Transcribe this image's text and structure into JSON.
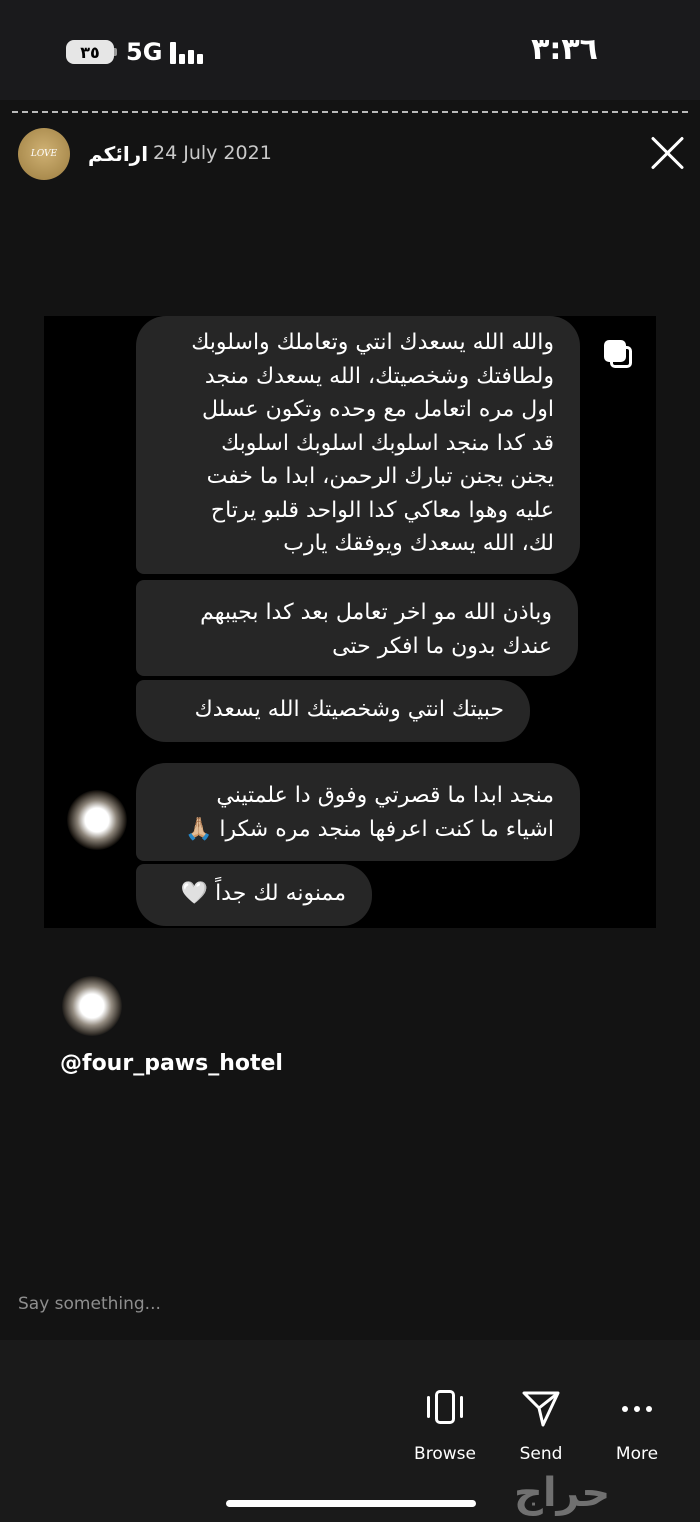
{
  "status_bar": {
    "battery": "٣٥",
    "network": "5G",
    "time": "٣:٣٦"
  },
  "story": {
    "username": "ارائكم",
    "date": "24 July 2021",
    "avatar_text": "LOVE",
    "mention": "@four_paws_hotel",
    "reply_placeholder": "Say something..."
  },
  "screenshot": {
    "messages": [
      "والله الله يسعدك انتي وتعاملك واسلوبك\nولطافتك وشخصيتك، الله يسعدك منجد\nاول مره اتعامل مع وحده وتكون عسلل\nقد كدا منجد اسلوبك اسلوبك اسلوبك\nيجنن يجنن تبارك الرحمن، ابدا ما خفت\nعليه وهوا معاكي كدا الواحد قلبو يرتاح\nلك، الله يسعدك ويوفقك يارب",
      "وباذن الله مو اخر تعامل بعد كدا بجيبهم\nعندك بدون ما افكر حتى",
      "حبيتك انتي وشخصيتك الله يسعدك",
      "منجد ابدا ما قصرتي وفوق دا علمتيني\nاشياء ما كنت اعرفها منجد مره شكرا 🙏🏼",
      "ممنونه لك جداً 🤍"
    ]
  },
  "toolbar": {
    "browse": "Browse",
    "send": "Send",
    "more": "More"
  },
  "watermark": "حراج"
}
